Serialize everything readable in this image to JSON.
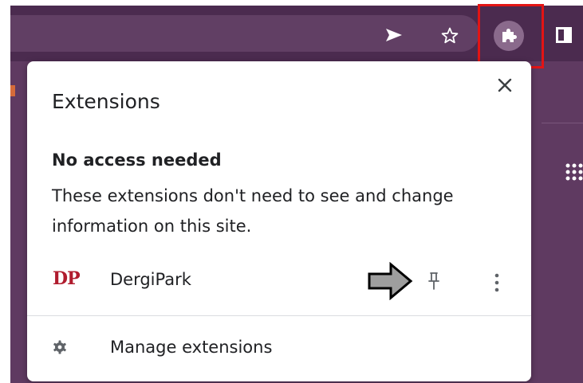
{
  "toolbar": {
    "send_icon": "send-icon",
    "bookmark_icon": "star-icon",
    "extensions_icon": "puzzle-icon",
    "side_panel_icon": "side-panel-icon",
    "highlight_color": "#e31414"
  },
  "popup": {
    "title": "Extensions",
    "section_heading": "No access needed",
    "section_description": "These extensions don't need to see and change information on this site.",
    "extensions": [
      {
        "logo_text": "DP",
        "name": "DergiPark"
      }
    ],
    "manage_label": "Manage extensions"
  },
  "colors": {
    "browser_theme": "#5f3a61",
    "dergipark_logo": "#b01c2e"
  }
}
